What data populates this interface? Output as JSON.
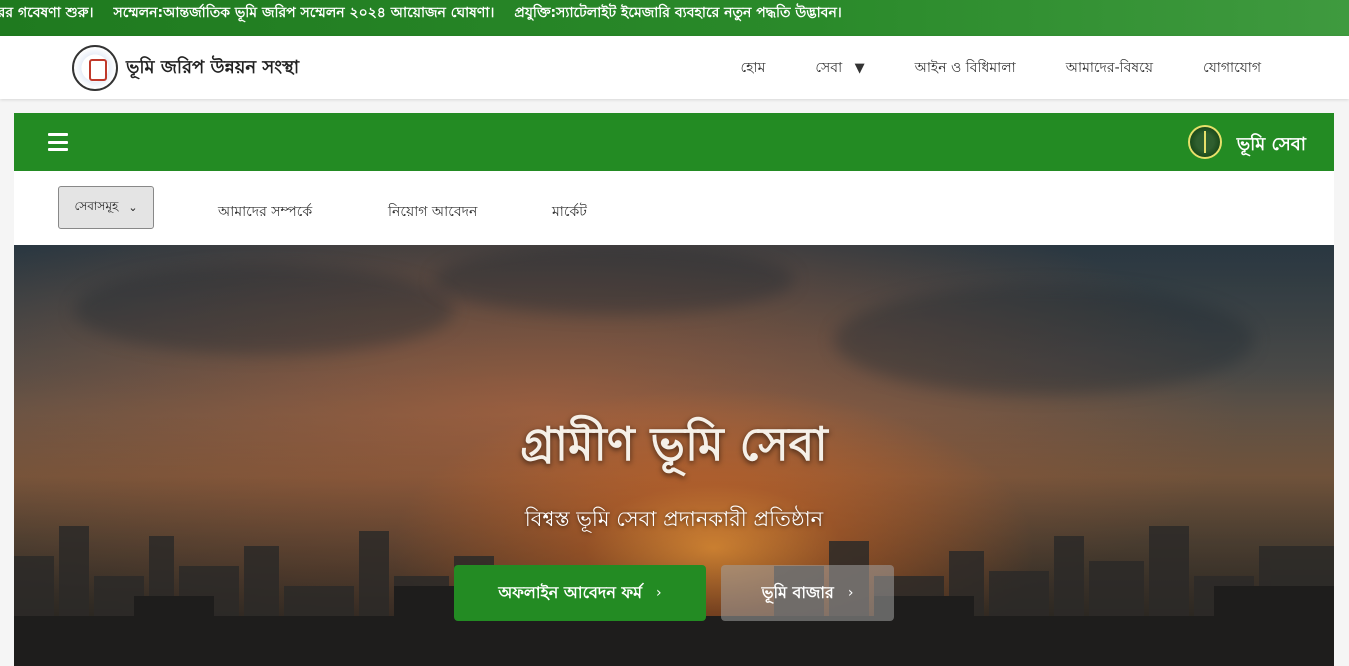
{
  "ticker": {
    "items": [
      "রের গবেষণা শুরু।",
      "সম্মেলন:আন্তর্জাতিক ভূমি জরিপ সম্মেলন ২০২৪ আয়োজন ঘোষণা।",
      "প্রযুক্তি:স্যাটেলাইট ইমেজারি ব্যবহারে নতুন পদ্ধতি উদ্ভাবন।"
    ]
  },
  "header": {
    "brand_name": "ভূমি জরিপ উন্নয়ন সংস্থা",
    "nav": [
      "হোম",
      "সেবা",
      "আইন ও বিধিমালা",
      "আমাদের-বিষয়ে",
      "যোগাযোগ"
    ],
    "dropdown_icon": "▼"
  },
  "service_bar": {
    "title": "ভূমি সেবা"
  },
  "subnav": {
    "select_label": "সেবাসমূহ",
    "links": [
      "আমাদের সম্পর্কে",
      "নিয়োগ আবেদন",
      "মার্কেট"
    ]
  },
  "hero": {
    "title": "গ্রামীণ ভূমি সেবা",
    "subtitle": "বিশ্বস্ত ভূমি সেবা প্রদানকারী প্রতিষ্ঠান",
    "primary_button": "অফলাইন আবেদন ফর্ম",
    "secondary_button": "ভূমি বাজার"
  },
  "colors": {
    "brand_green": "#238b23"
  }
}
